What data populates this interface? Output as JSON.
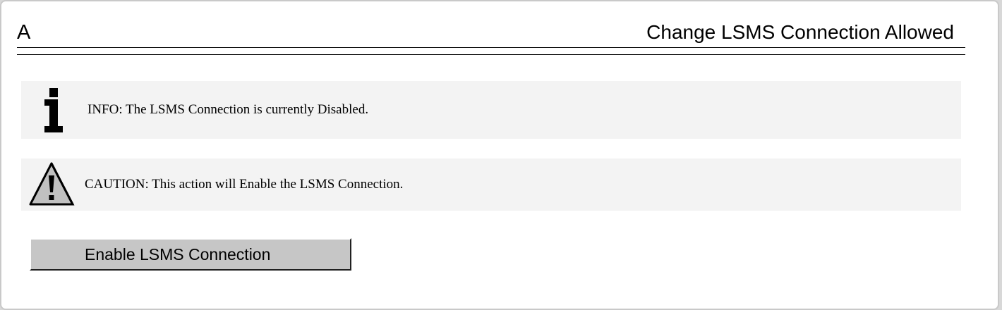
{
  "header": {
    "left_label": "A",
    "title": "Change LSMS Connection Allowed"
  },
  "info": {
    "icon": "info-icon",
    "text": "INFO: The LSMS Connection is currently Disabled."
  },
  "caution": {
    "icon": "warning-triangle-icon",
    "text": "CAUTION: This action will Enable the LSMS Connection."
  },
  "action": {
    "button_label": "Enable LSMS Connection"
  },
  "colors": {
    "message_background": "#f3f3f3",
    "button_face": "#c6c6c6",
    "page_background": "#ffffff"
  }
}
